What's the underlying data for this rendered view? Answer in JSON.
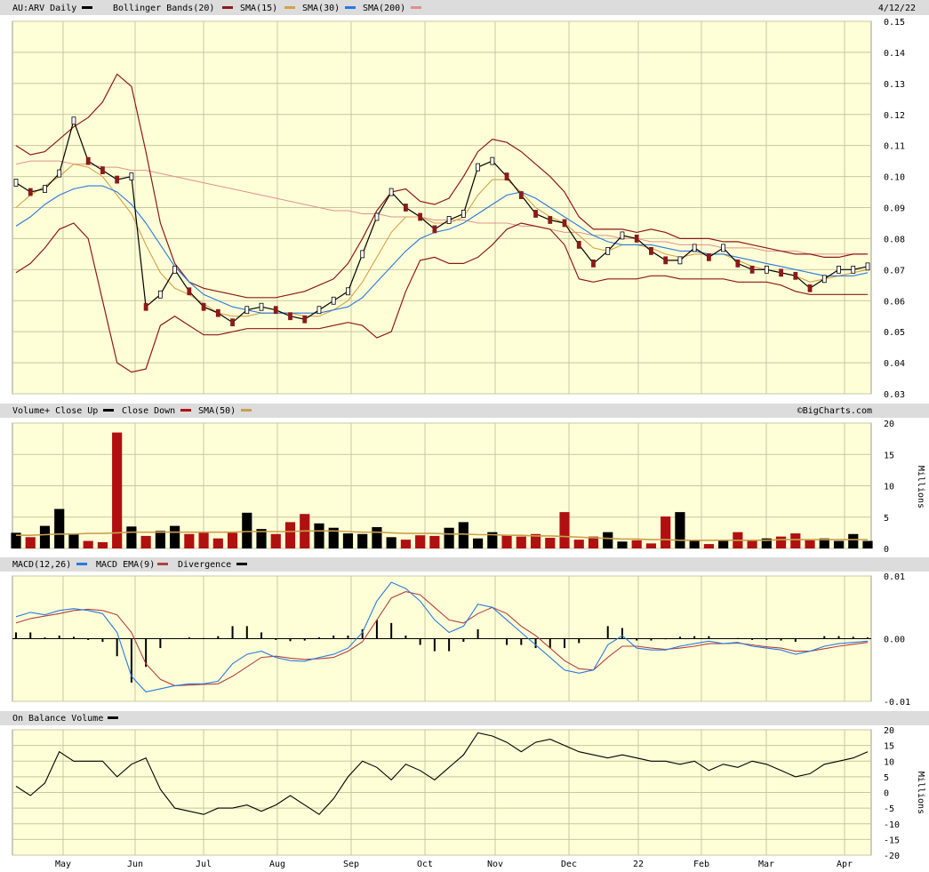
{
  "header": {
    "symbol": "AU:ARV Daily",
    "date": "4/12/22",
    "legend": [
      {
        "label": "Bollinger Bands(20)",
        "color": "#8b1a1a"
      },
      {
        "label": "SMA(15)",
        "color": "#d4a04a"
      },
      {
        "label": "SMA(30)",
        "color": "#2a78e0"
      },
      {
        "label": "SMA(200)",
        "color": "#e09090"
      }
    ]
  },
  "panels": {
    "volume": {
      "legend": [
        {
          "label": "Volume+ Close Up",
          "color": "#000000"
        },
        {
          "label": "Close Down",
          "color": "#b01010"
        },
        {
          "label": "SMA(50)",
          "color": "#c8a050"
        }
      ],
      "watermark": "©BigCharts.com",
      "unit": "Millions"
    },
    "macd": {
      "legend": [
        {
          "label": "MACD(12,26)",
          "color": "#2a78e0"
        },
        {
          "label": "MACD EMA(9)",
          "color": "#b04040"
        },
        {
          "label": "Divergence",
          "color": "#000000"
        }
      ]
    },
    "obv": {
      "legend": [
        {
          "label": "On Balance Volume",
          "color": "#000000"
        }
      ],
      "unit": "Millions"
    }
  },
  "chart_data": [
    {
      "type": "line",
      "panel": "price",
      "ylim": [
        0.03,
        0.15
      ],
      "yticks": [
        "0.15",
        "0.14",
        "0.13",
        "0.12",
        "0.11",
        "0.10",
        "0.09",
        "0.08",
        "0.07",
        "0.06",
        "0.05",
        "0.04",
        "0.03"
      ],
      "x_months": [
        "May",
        "Jun",
        "Jul",
        "Aug",
        "Sep",
        "Oct",
        "Nov",
        "Dec",
        "22",
        "Feb",
        "Mar",
        "Apr"
      ],
      "series": [
        {
          "name": "AU:ARV Daily",
          "color": "#000000",
          "values": [
            0.098,
            0.095,
            0.096,
            0.101,
            0.118,
            0.105,
            0.102,
            0.099,
            0.1,
            0.058,
            0.062,
            0.07,
            0.063,
            0.058,
            0.056,
            0.053,
            0.057,
            0.058,
            0.057,
            0.055,
            0.054,
            0.057,
            0.06,
            0.063,
            0.075,
            0.087,
            0.095,
            0.09,
            0.087,
            0.083,
            0.086,
            0.088,
            0.103,
            0.105,
            0.1,
            0.094,
            0.088,
            0.086,
            0.085,
            0.078,
            0.072,
            0.076,
            0.081,
            0.08,
            0.076,
            0.073,
            0.073,
            0.077,
            0.074,
            0.077,
            0.072,
            0.07,
            0.07,
            0.069,
            0.068,
            0.064,
            0.067,
            0.07,
            0.07,
            0.071
          ]
        },
        {
          "name": "SMA(15)",
          "color": "#d4a04a",
          "values": [
            0.09,
            0.094,
            0.097,
            0.1,
            0.104,
            0.103,
            0.1,
            0.094,
            0.088,
            0.078,
            0.069,
            0.064,
            0.062,
            0.059,
            0.056,
            0.055,
            0.055,
            0.056,
            0.056,
            0.056,
            0.055,
            0.055,
            0.057,
            0.06,
            0.066,
            0.074,
            0.082,
            0.087,
            0.087,
            0.085,
            0.085,
            0.087,
            0.094,
            0.099,
            0.099,
            0.095,
            0.09,
            0.087,
            0.085,
            0.081,
            0.077,
            0.076,
            0.078,
            0.078,
            0.077,
            0.075,
            0.074,
            0.075,
            0.075,
            0.075,
            0.073,
            0.071,
            0.07,
            0.069,
            0.068,
            0.066,
            0.067,
            0.068,
            0.069,
            0.07
          ]
        },
        {
          "name": "SMA(30)",
          "color": "#2a78e0",
          "values": [
            0.084,
            0.087,
            0.091,
            0.094,
            0.096,
            0.097,
            0.097,
            0.095,
            0.091,
            0.085,
            0.078,
            0.071,
            0.066,
            0.062,
            0.06,
            0.058,
            0.057,
            0.056,
            0.056,
            0.056,
            0.056,
            0.056,
            0.057,
            0.058,
            0.061,
            0.066,
            0.071,
            0.076,
            0.08,
            0.082,
            0.083,
            0.085,
            0.088,
            0.091,
            0.094,
            0.095,
            0.093,
            0.09,
            0.087,
            0.084,
            0.081,
            0.079,
            0.078,
            0.078,
            0.078,
            0.077,
            0.076,
            0.076,
            0.075,
            0.075,
            0.074,
            0.073,
            0.072,
            0.071,
            0.07,
            0.069,
            0.068,
            0.068,
            0.068,
            0.069
          ]
        },
        {
          "name": "SMA(200)",
          "color": "#e09090",
          "values": [
            0.104,
            0.105,
            0.105,
            0.105,
            0.104,
            0.104,
            0.103,
            0.103,
            0.102,
            0.102,
            0.101,
            0.1,
            0.099,
            0.098,
            0.097,
            0.096,
            0.095,
            0.094,
            0.093,
            0.092,
            0.091,
            0.09,
            0.089,
            0.089,
            0.088,
            0.088,
            0.087,
            0.087,
            0.087,
            0.086,
            0.086,
            0.086,
            0.085,
            0.085,
            0.085,
            0.084,
            0.084,
            0.083,
            0.082,
            0.082,
            0.081,
            0.081,
            0.08,
            0.08,
            0.079,
            0.079,
            0.078,
            0.078,
            0.078,
            0.077,
            0.077,
            0.077,
            0.076,
            0.076,
            0.076,
            0.075,
            0.075,
            0.075,
            0.075,
            0.075
          ]
        },
        {
          "name": "Bollinger Bands(20) upper",
          "color": "#8b1a1a",
          "values": [
            0.11,
            0.107,
            0.108,
            0.112,
            0.116,
            0.119,
            0.124,
            0.133,
            0.129,
            0.108,
            0.085,
            0.072,
            0.066,
            0.064,
            0.063,
            0.062,
            0.061,
            0.061,
            0.061,
            0.062,
            0.063,
            0.065,
            0.067,
            0.072,
            0.08,
            0.089,
            0.095,
            0.096,
            0.092,
            0.091,
            0.093,
            0.1,
            0.108,
            0.112,
            0.111,
            0.108,
            0.104,
            0.1,
            0.095,
            0.087,
            0.083,
            0.083,
            0.083,
            0.082,
            0.083,
            0.082,
            0.08,
            0.08,
            0.08,
            0.079,
            0.079,
            0.078,
            0.077,
            0.076,
            0.075,
            0.075,
            0.074,
            0.074,
            0.075,
            0.075
          ]
        },
        {
          "name": "Bollinger Bands(20) lower",
          "color": "#8b1a1a",
          "values": [
            0.069,
            0.072,
            0.077,
            0.083,
            0.085,
            0.08,
            0.06,
            0.04,
            0.037,
            0.038,
            0.052,
            0.055,
            0.052,
            0.049,
            0.049,
            0.05,
            0.051,
            0.051,
            0.051,
            0.051,
            0.051,
            0.051,
            0.052,
            0.053,
            0.052,
            0.048,
            0.05,
            0.063,
            0.073,
            0.074,
            0.072,
            0.072,
            0.074,
            0.078,
            0.083,
            0.085,
            0.084,
            0.083,
            0.078,
            0.067,
            0.066,
            0.067,
            0.067,
            0.067,
            0.068,
            0.068,
            0.067,
            0.067,
            0.067,
            0.067,
            0.066,
            0.066,
            0.066,
            0.065,
            0.063,
            0.062,
            0.062,
            0.062,
            0.062,
            0.062
          ]
        }
      ]
    },
    {
      "type": "bar",
      "panel": "volume",
      "ylim": [
        0,
        20
      ],
      "yticks": [
        "20",
        "15",
        "10",
        "5",
        "0"
      ],
      "ylabel": "Millions",
      "series": [
        {
          "name": "Volume",
          "values": [
            2.5,
            1.8,
            3.6,
            6.3,
            2.4,
            1.2,
            1.0,
            18.5,
            3.5,
            2.0,
            2.8,
            3.6,
            2.3,
            2.5,
            1.6,
            2.5,
            5.7,
            3.1,
            2.3,
            4.2,
            5.5,
            4.0,
            3.3,
            2.4,
            2.3,
            3.4,
            1.8,
            1.4,
            2.1,
            2.0,
            3.3,
            4.2,
            1.6,
            2.6,
            2.1,
            1.9,
            2.3,
            1.7,
            5.8,
            1.4,
            1.9,
            2.6,
            1.1,
            1.3,
            0.8,
            5.1,
            5.8,
            1.3,
            0.7,
            1.4,
            2.6,
            1.2,
            1.6,
            1.9,
            2.4,
            1.3,
            1.6,
            1.2,
            2.3,
            1.2
          ]
        },
        {
          "name": "SMA(50)",
          "color": "#c8a050",
          "values": [
            2.1,
            2.1,
            2.2,
            2.3,
            2.3,
            2.4,
            2.4,
            2.5,
            2.6,
            2.6,
            2.6,
            2.6,
            2.6,
            2.6,
            2.6,
            2.6,
            2.7,
            2.7,
            2.7,
            2.7,
            2.8,
            2.8,
            2.8,
            2.7,
            2.6,
            2.6,
            2.5,
            2.4,
            2.4,
            2.4,
            2.3,
            2.3,
            2.2,
            2.2,
            2.1,
            2.1,
            2.0,
            2.0,
            1.9,
            1.8,
            1.7,
            1.6,
            1.5,
            1.5,
            1.4,
            1.4,
            1.3,
            1.3,
            1.3,
            1.3,
            1.3,
            1.3,
            1.3,
            1.4,
            1.4,
            1.4,
            1.4,
            1.4,
            1.4,
            1.4
          ]
        }
      ]
    },
    {
      "type": "line",
      "panel": "macd",
      "ylim": [
        -0.01,
        0.01
      ],
      "yticks": [
        "0.01",
        "0.00",
        "-0.01"
      ],
      "series": [
        {
          "name": "MACD(12,26)",
          "color": "#2a78e0",
          "values": [
            0.0035,
            0.0042,
            0.0038,
            0.0045,
            0.0048,
            0.0045,
            0.004,
            0.001,
            -0.006,
            -0.0085,
            -0.008,
            -0.0075,
            -0.0072,
            -0.0072,
            -0.0068,
            -0.004,
            -0.0025,
            -0.002,
            -0.003,
            -0.0035,
            -0.0036,
            -0.003,
            -0.0025,
            -0.0015,
            0.001,
            0.006,
            0.009,
            0.008,
            0.006,
            0.003,
            0.001,
            0.002,
            0.0055,
            0.005,
            0.003,
            0.001,
            -0.001,
            -0.003,
            -0.005,
            -0.0055,
            -0.005,
            -0.001,
            0.0005,
            -0.0015,
            -0.0018,
            -0.0018,
            -0.0012,
            -0.0008,
            -0.0004,
            -0.0008,
            -0.0006,
            -0.0012,
            -0.0015,
            -0.0018,
            -0.0025,
            -0.002,
            -0.0012,
            -0.0008,
            -0.0006,
            -0.0004
          ]
        },
        {
          "name": "MACD EMA(9)",
          "color": "#b04040",
          "values": [
            0.0025,
            0.0032,
            0.0036,
            0.004,
            0.0045,
            0.0047,
            0.0045,
            0.0038,
            0.001,
            -0.004,
            -0.0065,
            -0.0075,
            -0.0074,
            -0.0073,
            -0.0072,
            -0.006,
            -0.0045,
            -0.003,
            -0.0028,
            -0.0031,
            -0.0033,
            -0.0032,
            -0.003,
            -0.002,
            -0.0005,
            0.003,
            0.0065,
            0.0075,
            0.007,
            0.005,
            0.003,
            0.0025,
            0.004,
            0.005,
            0.004,
            0.002,
            0.0005,
            -0.0015,
            -0.0035,
            -0.0048,
            -0.005,
            -0.003,
            -0.0012,
            -0.0012,
            -0.0015,
            -0.0017,
            -0.0015,
            -0.0012,
            -0.0008,
            -0.0008,
            -0.0007,
            -0.001,
            -0.0013,
            -0.0015,
            -0.002,
            -0.002,
            -0.0016,
            -0.0012,
            -0.0009,
            -0.0006
          ]
        },
        {
          "name": "Divergence",
          "color": "#000000",
          "values": [
            0.001,
            0.001,
            0.0002,
            0.0005,
            0.0003,
            -0.0002,
            -0.0005,
            -0.0028,
            -0.007,
            -0.0045,
            -0.0015,
            0.0,
            0.0002,
            0.0001,
            0.0004,
            0.002,
            0.002,
            0.001,
            -0.0002,
            -0.0004,
            -0.0003,
            0.0002,
            0.0005,
            0.0005,
            0.0015,
            0.003,
            0.0025,
            0.0005,
            -0.001,
            -0.002,
            -0.002,
            -0.0005,
            0.0015,
            0.0,
            -0.001,
            -0.001,
            -0.0015,
            -0.0015,
            -0.0015,
            -0.0007,
            0.0,
            0.002,
            0.0017,
            -0.0003,
            -0.0003,
            -0.0001,
            0.0003,
            0.0004,
            0.0004,
            0.0,
            0.0001,
            -0.0002,
            -0.0002,
            -0.0003,
            -0.0005,
            0.0,
            0.0004,
            0.0004,
            0.0003,
            0.0002
          ]
        }
      ]
    },
    {
      "type": "line",
      "panel": "obv",
      "ylim": [
        -20,
        20
      ],
      "yticks": [
        "20",
        "15",
        "10",
        "5",
        "0",
        "-5",
        "-10",
        "-15",
        "-20"
      ],
      "ylabel": "Millions",
      "series": [
        {
          "name": "On Balance Volume",
          "values": [
            2,
            -1,
            3,
            13,
            10,
            10,
            10,
            5,
            9,
            11,
            1,
            -5,
            -6,
            -7,
            -5,
            -5,
            -4,
            -6,
            -4,
            -1,
            -4,
            -7,
            -2,
            5,
            10,
            8,
            4,
            9,
            7,
            4,
            8,
            12,
            19,
            18,
            16,
            13,
            16,
            17,
            15,
            13,
            12,
            11,
            12,
            11,
            10,
            10,
            9,
            10,
            7,
            9,
            8,
            10,
            9,
            7,
            5,
            6,
            9,
            10,
            11,
            13
          ]
        }
      ]
    }
  ]
}
